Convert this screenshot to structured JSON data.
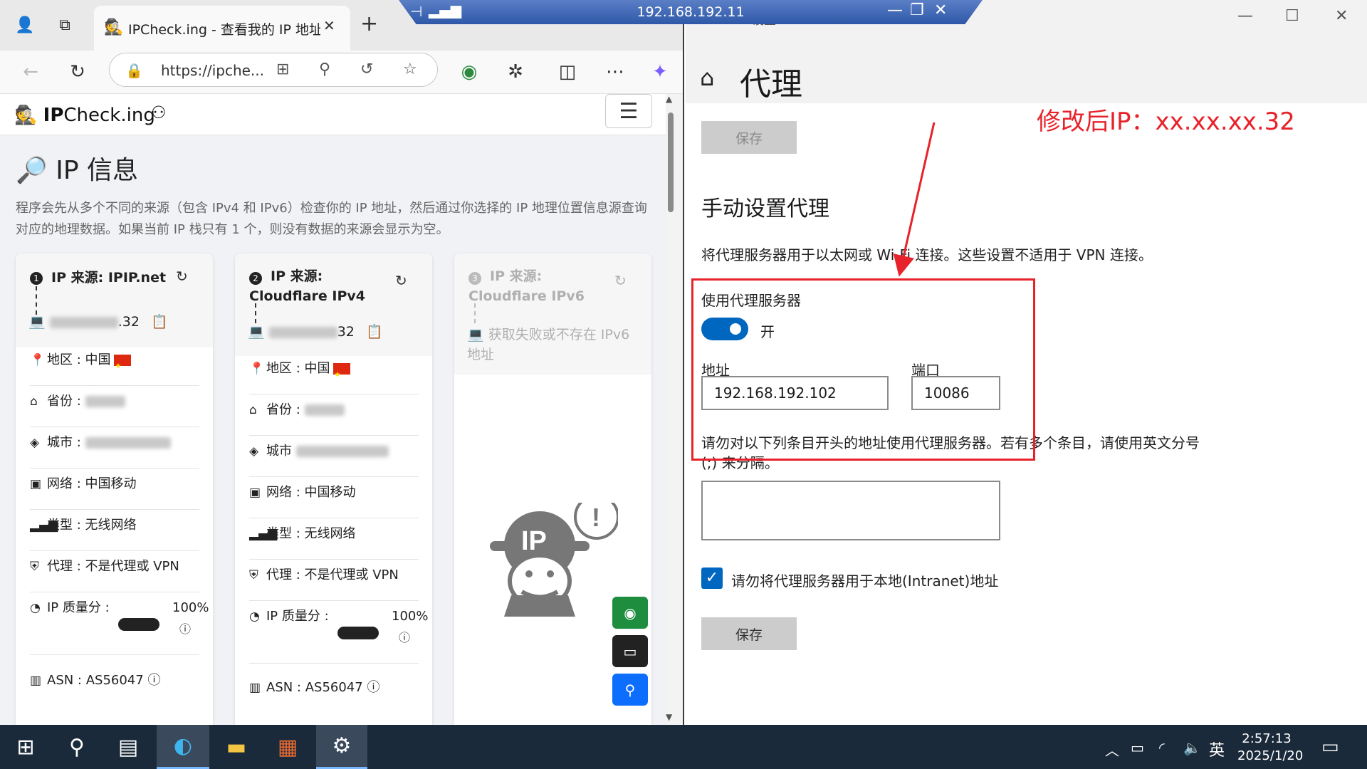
{
  "browser": {
    "tab_title": "IPCheck.ing - 查看我的 IP 地址 - I",
    "url": "https://ipche...",
    "page": {
      "logo_bold": "IP",
      "logo_rest": "Check.ing",
      "title": "IP 信息",
      "description": "程序会先从多个不同的来源（包含 IPv4 和 IPv6）检查你的 IP 地址，然后通过你选择的 IP 地理位置信息源查询对应的地理数据。如果当前 IP 栈只有 1 个，则没有数据的来源会显示为空。",
      "cards": [
        {
          "num": "1",
          "title": "IP 来源: IPIP.net",
          "ip_suffix": ".32",
          "rows": {
            "region": "地区 : 中国",
            "province": "省份 :",
            "city": "城市 :",
            "network": "网络 : 中国移动",
            "type": "类型 : 无线网络",
            "proxy": "代理 : 不是代理或 VPN",
            "quality_label": "IP 质量分 :",
            "quality_value": "100%",
            "asn": "ASN : AS56047"
          }
        },
        {
          "num": "2",
          "title": "IP 来源: Cloudflare IPv4",
          "ip_suffix": "32",
          "rows": {
            "region": "地区 : 中国",
            "province": "省份 :",
            "city": "城市",
            "network": "网络 : 中国移动",
            "type": "类型 : 无线网络",
            "proxy": "代理 : 不是代理或 VPN",
            "quality_label": "IP 质量分 :",
            "quality_value": "100%",
            "asn": "ASN : AS56047"
          }
        },
        {
          "num": "3",
          "title": "IP 来源: Cloudflare IPv6",
          "status": "获取失败或不存在 IPv6 地址"
        }
      ]
    }
  },
  "rdp": {
    "host": "192.168.192.11"
  },
  "settings": {
    "window_title": "设置",
    "page_title": "代理",
    "save_top": "保存",
    "manual_title": "手动设置代理",
    "manual_desc": "将代理服务器用于以太网或 Wi-Fi 连接。这些设置不适用于 VPN 连接。",
    "use_proxy_label": "使用代理服务器",
    "toggle_state": "开",
    "address_label": "地址",
    "address_value": "192.168.192.102",
    "port_label": "端口",
    "port_value": "10086",
    "exceptions_desc": "请勿对以下列条目开头的地址使用代理服务器。若有多个条目，请使用英文分号 (;) 来分隔。",
    "exceptions_value": "",
    "local_checkbox_label": "请勿将代理服务器用于本地(Intranet)地址",
    "local_checkbox_checked": true,
    "save_bottom": "保存"
  },
  "annotation": {
    "text": "修改后IP：xx.xx.xx.32",
    "color": "#e8222a"
  },
  "taskbar": {
    "input_method": "英",
    "time": "2:57:13",
    "date": "2025/1/20"
  },
  "colors": {
    "accent": "#0067c0",
    "success": "#1e8e3e",
    "primary_btn": "#0d6efd",
    "rdp_bar": "#2e58a8"
  }
}
